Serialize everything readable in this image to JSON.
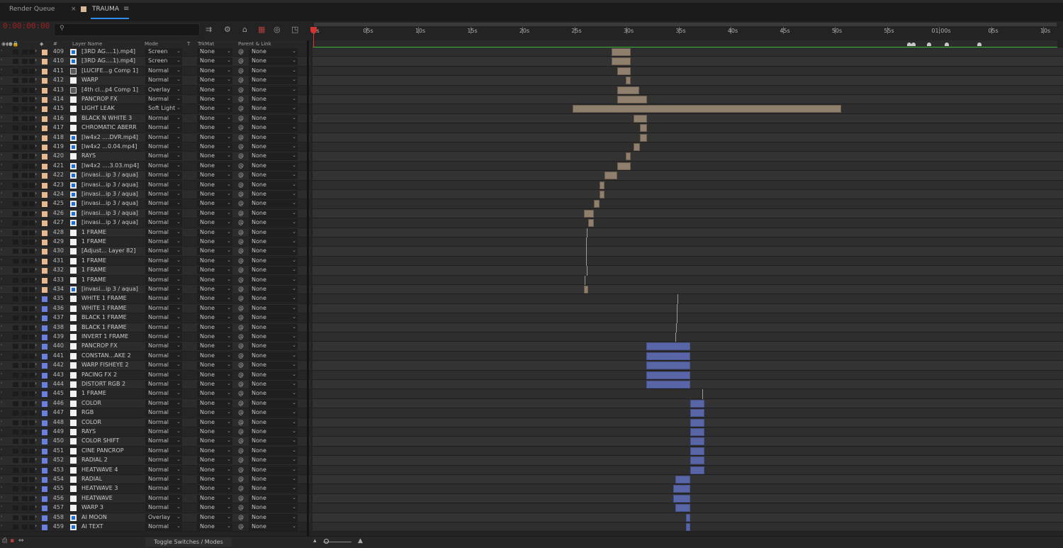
{
  "tabs": {
    "render_queue": "Render Queue",
    "comp": "TRAUMA",
    "close": "×",
    "menu": "≡"
  },
  "colors": {
    "timecode": "#9c2222",
    "tan_label": "#e8b98f",
    "blue_label": "#6b7fe0",
    "work_area": "#3ab53a",
    "playhead": "#d23333"
  },
  "timecode": "0:00:00:00",
  "search": {
    "placeholder": ""
  },
  "toolbar": [
    "comp-mini-flowchart-icon",
    "draft-3d-icon",
    "shy-icon",
    "frame-blending-icon",
    "motion-blur-icon",
    "graph-editor-icon"
  ],
  "headers": {
    "layer_name": "Layer Name",
    "num": "#",
    "mode": "Mode",
    "t": "T",
    "trkmat": "TrkMat",
    "parent": "Parent & Link"
  },
  "ruler": [
    "0s",
    "05s",
    "10s",
    "15s",
    "20s",
    "25s",
    "30s",
    "35s",
    "40s",
    "45s",
    "50s",
    "55s",
    "01:00s",
    "05s",
    "10s"
  ],
  "markers": [
    57.3,
    57.7,
    59.2,
    60.9,
    64.0
  ],
  "layers": [
    {
      "num": "409",
      "name": "[3RD AG....1).mp4]",
      "mode": "Screen",
      "trk": "None",
      "parent": "None",
      "label": "tan",
      "icon": "footage",
      "bar": {
        "s": 28.6,
        "e": 30.4,
        "k": "tan"
      }
    },
    {
      "num": "410",
      "name": "[3RD AG....1).mp4]",
      "mode": "Screen",
      "trk": "None",
      "parent": "None",
      "label": "tan",
      "icon": "footage",
      "bar": {
        "s": 28.6,
        "e": 30.4,
        "k": "tan"
      }
    },
    {
      "num": "411",
      "name": "[LUCIFE...g Comp 1]",
      "mode": "Normal",
      "trk": "None",
      "parent": "None",
      "label": "tan",
      "icon": "comp",
      "bar": {
        "s": 29.1,
        "e": 30.4,
        "k": "tan"
      }
    },
    {
      "num": "412",
      "name": "WARP",
      "mode": "Normal",
      "trk": "None",
      "parent": "None",
      "label": "tan",
      "icon": "solid",
      "bar": {
        "s": 29.9,
        "e": 30.4,
        "k": "tan"
      }
    },
    {
      "num": "413",
      "name": "[4th cl...p4 Comp 1]",
      "mode": "Overlay",
      "trk": "None",
      "parent": "None",
      "label": "tan",
      "icon": "comp",
      "bar": {
        "s": 29.1,
        "e": 31.2,
        "k": "tan"
      }
    },
    {
      "num": "414",
      "name": "PANCROP FX",
      "mode": "Normal",
      "trk": "None",
      "parent": "None",
      "label": "tan",
      "icon": "solid",
      "bar": {
        "s": 29.1,
        "e": 32.0,
        "k": "tan"
      }
    },
    {
      "num": "415",
      "name": "LIGHT LEAK",
      "mode": "Soft Light",
      "trk": "None",
      "parent": "None",
      "label": "tan",
      "icon": "solid",
      "bar": {
        "s": 24.8,
        "e": 50.6,
        "k": "tan"
      }
    },
    {
      "num": "416",
      "name": "BLACK N WHITE 3",
      "mode": "Normal",
      "trk": "None",
      "parent": "None",
      "label": "tan",
      "icon": "solid",
      "bar": {
        "s": 30.7,
        "e": 32.0,
        "k": "tan"
      }
    },
    {
      "num": "417",
      "name": "CHROMATIC ABERR",
      "mode": "Normal",
      "trk": "None",
      "parent": "None",
      "label": "tan",
      "icon": "solid",
      "bar": {
        "s": 31.3,
        "e": 32.0,
        "k": "tan"
      }
    },
    {
      "num": "418",
      "name": "[lw4x2 ....DVR.mp4]",
      "mode": "Normal",
      "trk": "None",
      "parent": "None",
      "label": "tan",
      "icon": "footage",
      "bar": {
        "s": 31.3,
        "e": 32.0,
        "k": "tan"
      }
    },
    {
      "num": "419",
      "name": "[lw4x2 ...0.04.mp4]",
      "mode": "Normal",
      "trk": "None",
      "parent": "None",
      "label": "tan",
      "icon": "footage",
      "bar": {
        "s": 30.7,
        "e": 31.3,
        "k": "tan"
      }
    },
    {
      "num": "420",
      "name": "RAYS",
      "mode": "Normal",
      "trk": "None",
      "parent": "None",
      "label": "tan",
      "icon": "solid",
      "bar": {
        "s": 29.9,
        "e": 30.4,
        "k": "tan"
      }
    },
    {
      "num": "421",
      "name": "[lw4x2 ....3.03.mp4]",
      "mode": "Normal",
      "trk": "None",
      "parent": "None",
      "label": "tan",
      "icon": "footage",
      "bar": {
        "s": 29.1,
        "e": 30.4,
        "k": "tan"
      }
    },
    {
      "num": "422",
      "name": "[invasi...ip 3 / aqua]",
      "mode": "Normal",
      "trk": "None",
      "parent": "None",
      "label": "tan",
      "icon": "footage",
      "bar": {
        "s": 27.9,
        "e": 29.1,
        "k": "tan"
      }
    },
    {
      "num": "423",
      "name": "[invasi...ip 3 / aqua]",
      "mode": "Normal",
      "trk": "None",
      "parent": "None",
      "label": "tan",
      "icon": "footage",
      "bar": {
        "s": 27.4,
        "e": 27.9,
        "k": "tan"
      }
    },
    {
      "num": "424",
      "name": "[invasi...ip 3 / aqua]",
      "mode": "Normal",
      "trk": "None",
      "parent": "None",
      "label": "tan",
      "icon": "footage",
      "bar": {
        "s": 27.4,
        "e": 27.9,
        "k": "tan"
      }
    },
    {
      "num": "425",
      "name": "[invasi...ip 3 / aqua]",
      "mode": "Normal",
      "trk": "None",
      "parent": "None",
      "label": "tan",
      "icon": "footage",
      "bar": {
        "s": 26.9,
        "e": 27.4,
        "k": "tan"
      }
    },
    {
      "num": "426",
      "name": "[invasi...ip 3 / aqua]",
      "mode": "Normal",
      "trk": "None",
      "parent": "None",
      "label": "tan",
      "icon": "footage",
      "bar": {
        "s": 25.9,
        "e": 26.9,
        "k": "tan"
      }
    },
    {
      "num": "427",
      "name": "[invasi...ip 3 / aqua]",
      "mode": "Normal",
      "trk": "None",
      "parent": "None",
      "label": "tan",
      "icon": "footage",
      "bar": {
        "s": 26.3,
        "e": 26.9,
        "k": "tan"
      }
    },
    {
      "num": "428",
      "name": "1 FRAME",
      "mode": "Normal",
      "trk": "None",
      "parent": "None",
      "label": "tan",
      "icon": "solid",
      "bar": {
        "s": 26.2,
        "e": 26.24,
        "k": "thin"
      }
    },
    {
      "num": "429",
      "name": "1 FRAME",
      "mode": "Normal",
      "trk": "None",
      "parent": "None",
      "label": "tan",
      "icon": "solid",
      "bar": {
        "s": 26.15,
        "e": 26.19,
        "k": "thin"
      }
    },
    {
      "num": "430",
      "name": "[Adjust... Layer 82]",
      "mode": "Normal",
      "trk": "None",
      "parent": "None",
      "label": "tan",
      "icon": "solid",
      "bar": {
        "s": 26.1,
        "e": 26.14,
        "k": "thin"
      }
    },
    {
      "num": "431",
      "name": "1 FRAME",
      "mode": "Normal",
      "trk": "None",
      "parent": "None",
      "label": "tan",
      "icon": "solid",
      "bar": {
        "s": 26.15,
        "e": 26.19,
        "k": "thin"
      }
    },
    {
      "num": "432",
      "name": "1 FRAME",
      "mode": "Normal",
      "trk": "None",
      "parent": "None",
      "label": "tan",
      "icon": "solid",
      "bar": {
        "s": 26.2,
        "e": 26.24,
        "k": "thin"
      }
    },
    {
      "num": "433",
      "name": "1 FRAME",
      "mode": "Normal",
      "trk": "None",
      "parent": "None",
      "label": "tan",
      "icon": "solid",
      "bar": {
        "s": 26.0,
        "e": 26.04,
        "k": "thin"
      }
    },
    {
      "num": "434",
      "name": "[invasi...ip 3 / aqua]",
      "mode": "Normal",
      "trk": "None",
      "parent": "None",
      "label": "tan",
      "icon": "footage",
      "bar": {
        "s": 25.9,
        "e": 26.3,
        "k": "tan"
      }
    },
    {
      "num": "435",
      "name": "WHITE 1 FRAME",
      "mode": "Normal",
      "trk": "None",
      "parent": "None",
      "label": "blue",
      "icon": "solid",
      "bar": {
        "s": 34.9,
        "e": 34.95,
        "k": "thin"
      }
    },
    {
      "num": "436",
      "name": "WHITE 1 FRAME",
      "mode": "Normal",
      "trk": "None",
      "parent": "None",
      "label": "blue",
      "icon": "solid",
      "bar": {
        "s": 34.85,
        "e": 34.9,
        "k": "thin"
      }
    },
    {
      "num": "437",
      "name": "BLACK 1 FRAME",
      "mode": "Normal",
      "trk": "None",
      "parent": "None",
      "label": "blue",
      "icon": "solid",
      "bar": {
        "s": 34.8,
        "e": 34.85,
        "k": "thin"
      }
    },
    {
      "num": "438",
      "name": "BLACK 1 FRAME",
      "mode": "Normal",
      "trk": "None",
      "parent": "None",
      "label": "blue",
      "icon": "solid",
      "bar": {
        "s": 34.75,
        "e": 34.8,
        "k": "thin"
      }
    },
    {
      "num": "439",
      "name": "INVERT 1 FRAME",
      "mode": "Normal",
      "trk": "None",
      "parent": "None",
      "label": "blue",
      "icon": "solid",
      "bar": {
        "s": 34.7,
        "e": 34.75,
        "k": "thin"
      }
    },
    {
      "num": "440",
      "name": "PANCROP FX",
      "mode": "Normal",
      "trk": "None",
      "parent": "None",
      "label": "blue",
      "icon": "solid",
      "bar": {
        "s": 31.9,
        "e": 36.1,
        "k": "blue"
      }
    },
    {
      "num": "441",
      "name": "CONSTAN...AKE 2",
      "mode": "Normal",
      "trk": "None",
      "parent": "None",
      "label": "blue",
      "icon": "solid",
      "bar": {
        "s": 31.9,
        "e": 36.1,
        "k": "blue"
      }
    },
    {
      "num": "442",
      "name": "WARP FISHEYE 2",
      "mode": "Normal",
      "trk": "None",
      "parent": "None",
      "label": "blue",
      "icon": "solid",
      "bar": {
        "s": 31.9,
        "e": 36.1,
        "k": "blue"
      }
    },
    {
      "num": "443",
      "name": "PACING FX 2",
      "mode": "Normal",
      "trk": "None",
      "parent": "None",
      "label": "blue",
      "icon": "solid",
      "bar": {
        "s": 31.9,
        "e": 36.1,
        "k": "blue"
      }
    },
    {
      "num": "444",
      "name": "DISTORT RGB 2",
      "mode": "Normal",
      "trk": "None",
      "parent": "None",
      "label": "blue",
      "icon": "solid",
      "bar": {
        "s": 31.9,
        "e": 36.1,
        "k": "blue"
      }
    },
    {
      "num": "445",
      "name": "1 FRAME",
      "mode": "Normal",
      "trk": "None",
      "parent": "None",
      "label": "blue",
      "icon": "solid",
      "bar": {
        "s": 37.3,
        "e": 37.35,
        "k": "thin"
      }
    },
    {
      "num": "446",
      "name": "COLOR",
      "mode": "Normal",
      "trk": "None",
      "parent": "None",
      "label": "blue",
      "icon": "solid",
      "bar": {
        "s": 36.1,
        "e": 37.5,
        "k": "blue"
      }
    },
    {
      "num": "447",
      "name": "RGB",
      "mode": "Normal",
      "trk": "None",
      "parent": "None",
      "label": "blue",
      "icon": "solid",
      "bar": {
        "s": 36.1,
        "e": 37.5,
        "k": "blue"
      }
    },
    {
      "num": "448",
      "name": "COLOR",
      "mode": "Normal",
      "trk": "None",
      "parent": "None",
      "label": "blue",
      "icon": "solid",
      "bar": {
        "s": 36.1,
        "e": 37.5,
        "k": "blue"
      }
    },
    {
      "num": "449",
      "name": "RAYS",
      "mode": "Normal",
      "trk": "None",
      "parent": "None",
      "label": "blue",
      "icon": "solid",
      "bar": {
        "s": 36.1,
        "e": 37.5,
        "k": "blue"
      }
    },
    {
      "num": "450",
      "name": "COLOR SHIFT",
      "mode": "Normal",
      "trk": "None",
      "parent": "None",
      "label": "blue",
      "icon": "solid",
      "bar": {
        "s": 36.1,
        "e": 37.5,
        "k": "blue"
      }
    },
    {
      "num": "451",
      "name": "CINE PANCROP",
      "mode": "Normal",
      "trk": "None",
      "parent": "None",
      "label": "blue",
      "icon": "solid",
      "bar": {
        "s": 36.1,
        "e": 37.5,
        "k": "blue"
      }
    },
    {
      "num": "452",
      "name": "RADIAL 2",
      "mode": "Normal",
      "trk": "None",
      "parent": "None",
      "label": "blue",
      "icon": "solid",
      "bar": {
        "s": 36.1,
        "e": 37.5,
        "k": "blue"
      }
    },
    {
      "num": "453",
      "name": "HEATWAVE 4",
      "mode": "Normal",
      "trk": "None",
      "parent": "None",
      "label": "blue",
      "icon": "solid",
      "bar": {
        "s": 36.1,
        "e": 37.5,
        "k": "blue"
      }
    },
    {
      "num": "454",
      "name": "RADIAL",
      "mode": "Normal",
      "trk": "None",
      "parent": "None",
      "label": "blue",
      "icon": "solid",
      "bar": {
        "s": 34.7,
        "e": 36.1,
        "k": "blue"
      }
    },
    {
      "num": "455",
      "name": "HEATWAVE 3",
      "mode": "Normal",
      "trk": "None",
      "parent": "None",
      "label": "blue",
      "icon": "solid",
      "bar": {
        "s": 34.5,
        "e": 36.1,
        "k": "blue"
      }
    },
    {
      "num": "456",
      "name": "HEATWAVE",
      "mode": "Normal",
      "trk": "None",
      "parent": "None",
      "label": "blue",
      "icon": "solid",
      "bar": {
        "s": 34.5,
        "e": 36.1,
        "k": "blue"
      }
    },
    {
      "num": "457",
      "name": "WARP 3",
      "mode": "Normal",
      "trk": "None",
      "parent": "None",
      "label": "blue",
      "icon": "solid",
      "bar": {
        "s": 34.7,
        "e": 36.1,
        "k": "blue"
      }
    },
    {
      "num": "458",
      "name": "AI MOON",
      "mode": "Overlay",
      "trk": "None",
      "parent": "None",
      "label": "blue",
      "icon": "footage",
      "bar": {
        "s": 35.7,
        "e": 36.1,
        "k": "blue"
      }
    },
    {
      "num": "459",
      "name": "AI TEXT",
      "mode": "Normal",
      "trk": "None",
      "parent": "None",
      "label": "blue",
      "icon": "footage",
      "bar": {
        "s": 35.7,
        "e": 36.1,
        "k": "blue"
      }
    }
  ],
  "bottom": {
    "toggle": "Toggle Switches / Modes"
  }
}
